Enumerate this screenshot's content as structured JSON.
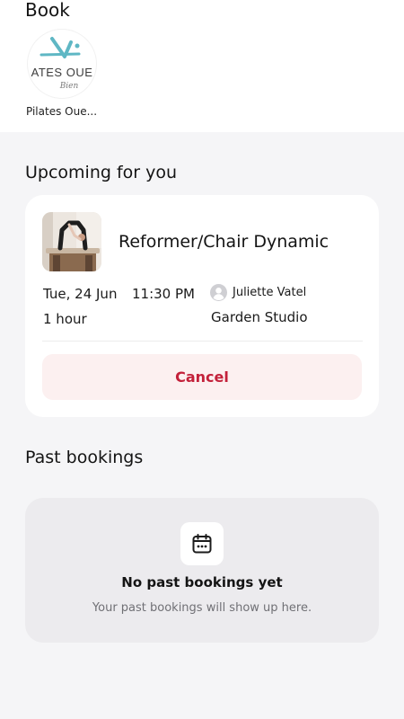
{
  "header": {
    "title": "Book"
  },
  "studio": {
    "name": "Pilates Oue...",
    "logo_text": "ATES OUE",
    "logo_script": "Bien"
  },
  "upcoming": {
    "section_title": "Upcoming for you",
    "booking": {
      "class_name": "Reformer/Chair Dynamic",
      "date": "Tue, 24 Jun",
      "time": "11:30 PM",
      "duration": "1 hour",
      "instructor": "Juliette Vatel",
      "location": "Garden Studio",
      "cancel_label": "Cancel"
    }
  },
  "past": {
    "section_title": "Past bookings",
    "empty_title": "No past bookings yet",
    "empty_subtitle": "Your past bookings will show up here."
  },
  "colors": {
    "page_background": "#f5f5f7",
    "card_background": "#ffffff",
    "cancel_background": "#fcf0f0",
    "cancel_text": "#c3213a",
    "logo_accent": "#5fb7c4",
    "empty_panel": "#ecebee"
  },
  "icons": {
    "avatar": "user-avatar-icon",
    "calendar": "calendar-icon"
  }
}
